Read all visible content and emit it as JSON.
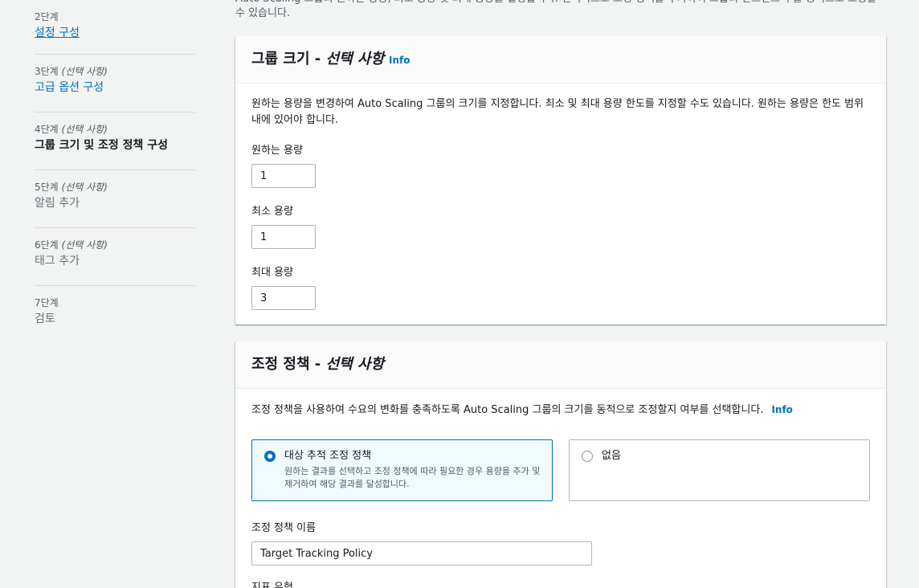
{
  "sidebar": {
    "steps": [
      {
        "number": "2단계",
        "optional": "",
        "title": "설정 구성",
        "state": "link"
      },
      {
        "number": "3단계",
        "optional": "(선택 사항)",
        "title": "고급 옵션 구성",
        "state": "link-plain"
      },
      {
        "number": "4단계",
        "optional": "(선택 사항)",
        "title": "그룹 크기 및 조정 정책 구성",
        "state": "current"
      },
      {
        "number": "5단계",
        "optional": "(선택 사항)",
        "title": "알림 추가",
        "state": "disabled"
      },
      {
        "number": "6단계",
        "optional": "(선택 사항)",
        "title": "태그 추가",
        "state": "disabled"
      },
      {
        "number": "7단계",
        "optional": "",
        "title": "검토",
        "state": "disabled"
      }
    ]
  },
  "intro": {
    "text": "Auto Scaling 그룹의 원하는 용량, 최소 용량 및 최대 용량을 설정합니다. 선택적으로 조정 정책을 추가하여 그룹의 인스턴스 수를 동적으로 조정할 수 있습니다."
  },
  "group_size": {
    "title": "그룹 크기 - ",
    "title_optional": "선택 사항",
    "info": "Info",
    "description": "원하는 용량을 변경하여 Auto Scaling 그룹의 크기를 지정합니다. 최소 및 최대 용량 한도를 지정할 수도 있습니다. 원하는 용량은 한도 범위 내에 있어야 합니다.",
    "desired_label": "원하는 용량",
    "desired_value": "1",
    "min_label": "최소 용량",
    "min_value": "1",
    "max_label": "최대 용량",
    "max_value": "3"
  },
  "scaling_policy": {
    "title": "조정 정책 - ",
    "title_optional": "선택 사항",
    "description": "조정 정책을 사용하여 수요의 변화를 충족하도록 Auto Scaling 그룹의 크기를 동적으로 조정할지 여부를 선택합니다.",
    "info": "Info",
    "option_target": {
      "title": "대상 추적 조정 정책",
      "description": "원하는 결과를 선택하고 조정 정책에 따라 필요한 경우 용량을 추가 및 제거하여 해당 결과를 달성합니다.",
      "selected": true
    },
    "option_none": {
      "title": "없음",
      "selected": false
    },
    "policy_name_label": "조정 정책 이름",
    "policy_name_value": "Target Tracking Policy",
    "metric_type_label": "지표 유형"
  }
}
